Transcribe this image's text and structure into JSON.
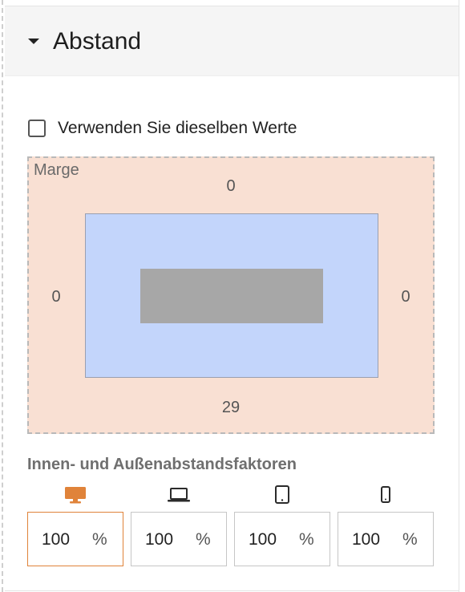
{
  "section": {
    "title": "Abstand"
  },
  "same_values": {
    "label": "Verwenden Sie dieselben Werte",
    "checked": false
  },
  "margin": {
    "label": "Marge",
    "top": "0",
    "right": "0",
    "bottom": "29",
    "left": "0"
  },
  "factors": {
    "title": "Innen- und Außenabstandsfaktoren",
    "active_color": "#e0833a",
    "devices": [
      {
        "icon": "desktop-icon",
        "value": "100",
        "unit": "%",
        "active": true
      },
      {
        "icon": "laptop-icon",
        "value": "100",
        "unit": "%",
        "active": false
      },
      {
        "icon": "tablet-icon",
        "value": "100",
        "unit": "%",
        "active": false
      },
      {
        "icon": "phone-icon",
        "value": "100",
        "unit": "%",
        "active": false
      }
    ]
  },
  "colors": {
    "margin_fill": "#f9e0d3",
    "padding_fill": "#c3d5fb",
    "content_fill": "#a7a7a7"
  }
}
